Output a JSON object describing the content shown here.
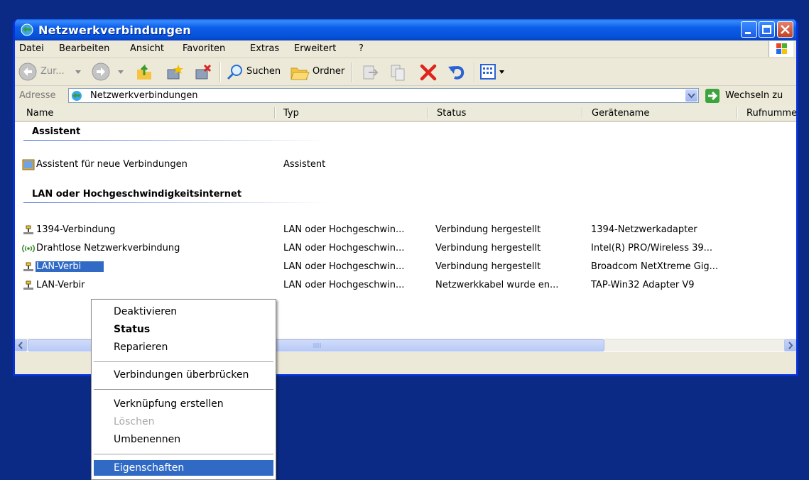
{
  "window": {
    "title": "Netzwerkverbindungen"
  },
  "menubar": {
    "items": [
      "Datei",
      "Bearbeiten",
      "Ansicht",
      "Favoriten",
      "Extras",
      "Erweitert",
      "?"
    ]
  },
  "toolbar": {
    "back_label": "Zur...",
    "search_label": "Suchen",
    "folders_label": "Ordner"
  },
  "address": {
    "label": "Adresse",
    "value": "Netzwerkverbindungen",
    "go_label": "Wechseln zu"
  },
  "columns": [
    "Name",
    "Typ",
    "Status",
    "Gerätename",
    "Rufnumme"
  ],
  "groups": [
    {
      "title": "Assistent",
      "items": [
        {
          "name": "Assistent für neue Verbindungen",
          "type": "Assistent",
          "status": "",
          "device": "",
          "icon": "wizard-icon"
        }
      ]
    },
    {
      "title": "LAN oder Hochgeschwindigkeitsinternet",
      "items": [
        {
          "name": "1394-Verbindung",
          "type": "LAN oder Hochgeschwin...",
          "status": "Verbindung hergestellt",
          "device": "1394-Netzwerkadapter",
          "icon": "network-connection-icon"
        },
        {
          "name": "Drahtlose Netzwerkverbindung",
          "type": "LAN oder Hochgeschwin...",
          "status": "Verbindung hergestellt",
          "device": "Intel(R) PRO/Wireless 39...",
          "icon": "wireless-icon"
        },
        {
          "name": "LAN-Verbi",
          "type": "LAN oder Hochgeschwin...",
          "status": "Verbindung hergestellt",
          "device": "Broadcom NetXtreme Gig...",
          "icon": "network-connection-icon",
          "selected": true
        },
        {
          "name": "LAN-Verbir",
          "type": "LAN oder Hochgeschwin...",
          "status": "Netzwerkkabel wurde en...",
          "device": "TAP-Win32 Adapter V9",
          "icon": "network-connection-icon"
        }
      ]
    }
  ],
  "context_menu": {
    "items": [
      {
        "label": "Deaktivieren"
      },
      {
        "label": "Status",
        "bold": true
      },
      {
        "label": "Reparieren"
      },
      {
        "label": "Verbindungen überbrücken"
      },
      {
        "label": "Verknüpfung erstellen"
      },
      {
        "label": "Löschen",
        "disabled": true
      },
      {
        "label": "Umbenennen"
      },
      {
        "label": "Eigenschaften",
        "highlighted": true
      }
    ]
  },
  "colors": {
    "desktop": "#0a2a86",
    "title_blue": "#0b5ee8",
    "selection": "#316ac5",
    "close_red": "#c3401f",
    "go_green": "#3ca43c"
  }
}
